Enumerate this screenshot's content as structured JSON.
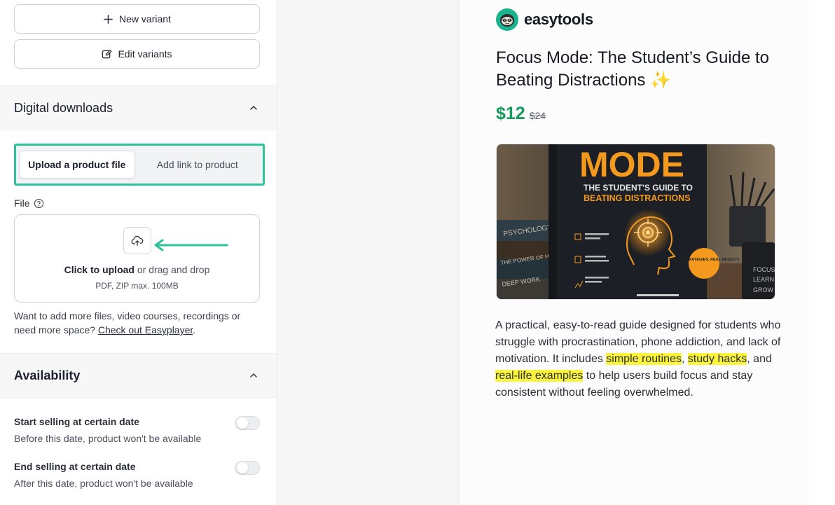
{
  "left": {
    "new_variant_label": "New variant",
    "edit_variants_label": "Edit variants",
    "digital_downloads": {
      "title": "Digital downloads",
      "tabs": [
        {
          "label": "Upload a product file",
          "active": true
        },
        {
          "label": "Add link to product",
          "active": false
        }
      ],
      "file_label": "File",
      "dropzone": {
        "click_text": "Click to upload",
        "drag_text": " or drag and drop",
        "hint": "PDF, ZIP max. 100MB"
      },
      "more_info_text": "Want to add more files, video courses, recordings or need more space? ",
      "more_info_link": "Check out Easyplayer",
      "more_info_end": "."
    },
    "availability": {
      "title": "Availability",
      "start": {
        "title": "Start selling at certain date",
        "desc": "Before this date, product won't be available",
        "enabled": false
      },
      "end": {
        "title": "End selling at certain date",
        "desc": "After this date, product won't be available",
        "enabled": false
      }
    }
  },
  "preview": {
    "brand": "easytools",
    "title": "Focus Mode: The Student’s Guide to Beating Distractions",
    "title_emoji": "✨",
    "price": "$12",
    "old_price": "$24",
    "cover": {
      "mode_text": "MODE",
      "subtitle_1": "THE STUDENT'S GUIDE TO",
      "subtitle_2": "BEATING DISTRACTIONS",
      "book_spine_1": "PSYCHOLOGY",
      "book_spine_2": "THE POWER OF HABIT",
      "book_spine_3": "DEEP WORK",
      "badge": "SIMPLE STRATEGIES, REAL RESULTS",
      "mug_words": [
        "FOCUS",
        "LEARN",
        "GROW"
      ]
    },
    "description": {
      "part1": "A practical, easy-to-read guide designed for students who struggle with procrastination, phone addiction, and lack of motivation. It includes ",
      "hl1": "simple routines",
      "part2": ", ",
      "hl2": "study hacks",
      "part3": ", and ",
      "hl3": "real-life examples",
      "part4": " to help users build focus and stay consistent without feeling overwhelmed."
    }
  },
  "colors": {
    "accent": "#2cc39a",
    "price": "#149b5c",
    "highlight": "#fdf53a",
    "cover_orange": "#f39a1e"
  }
}
